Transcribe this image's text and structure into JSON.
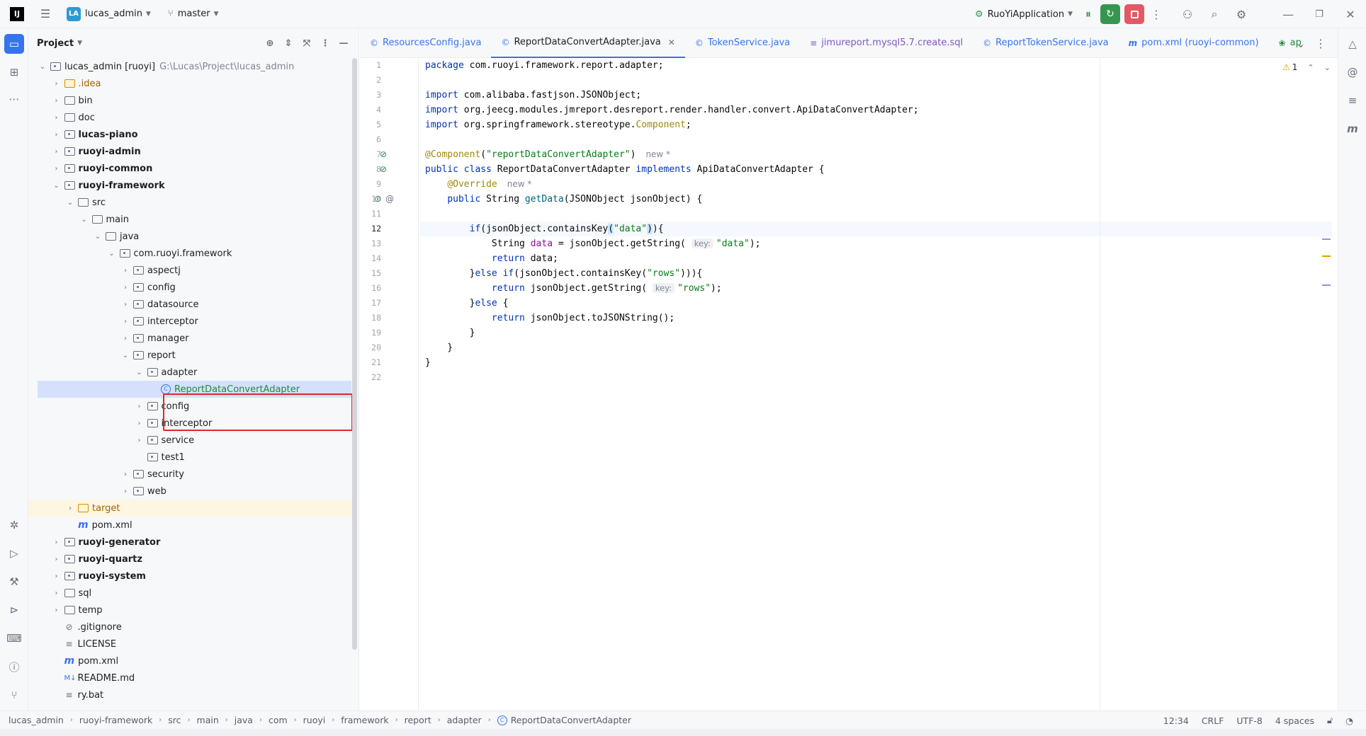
{
  "titlebar": {
    "app_logo": "IJ",
    "project_badge": "LA",
    "project_name": "lucas_admin",
    "branch": "master",
    "run_config": "RuoYiApplication",
    "icons": [
      "hamburger-icon",
      "branch-icon",
      "run-config-icon",
      "debug-icon",
      "rerun-icon",
      "stop-icon",
      "more-icon",
      "add-user-icon",
      "search-icon",
      "settings-icon",
      "minimize-icon",
      "restore-icon",
      "close-icon"
    ]
  },
  "project_panel": {
    "title": "Project",
    "tree": [
      {
        "label": "lucas_admin [ruoyi]",
        "path": "G:\\Lucas\\Project\\lucas_admin",
        "depth": 0,
        "expanded": true,
        "type": "module"
      },
      {
        "label": ".idea",
        "depth": 1,
        "type": "folder",
        "style": "orange"
      },
      {
        "label": "bin",
        "depth": 1,
        "type": "folder"
      },
      {
        "label": "doc",
        "depth": 1,
        "type": "folder"
      },
      {
        "label": "lucas-piano",
        "depth": 1,
        "type": "module",
        "bold": true
      },
      {
        "label": "ruoyi-admin",
        "depth": 1,
        "type": "module",
        "bold": true
      },
      {
        "label": "ruoyi-common",
        "depth": 1,
        "type": "module",
        "bold": true
      },
      {
        "label": "ruoyi-framework",
        "depth": 1,
        "type": "module",
        "bold": true,
        "expanded": true
      },
      {
        "label": "src",
        "depth": 2,
        "type": "folder",
        "expanded": true
      },
      {
        "label": "main",
        "depth": 3,
        "type": "folder",
        "expanded": true
      },
      {
        "label": "java",
        "depth": 4,
        "type": "folder",
        "expanded": true
      },
      {
        "label": "com.ruoyi.framework",
        "depth": 5,
        "type": "package",
        "expanded": true
      },
      {
        "label": "aspectj",
        "depth": 6,
        "type": "package"
      },
      {
        "label": "config",
        "depth": 6,
        "type": "package"
      },
      {
        "label": "datasource",
        "depth": 6,
        "type": "package"
      },
      {
        "label": "interceptor",
        "depth": 6,
        "type": "package"
      },
      {
        "label": "manager",
        "depth": 6,
        "type": "package"
      },
      {
        "label": "report",
        "depth": 6,
        "type": "package",
        "expanded": true
      },
      {
        "label": "adapter",
        "depth": 7,
        "type": "package",
        "expanded": true
      },
      {
        "label": "ReportDataConvertAdapter",
        "depth": 8,
        "type": "class",
        "selected": true,
        "style": "green"
      },
      {
        "label": "config",
        "depth": 7,
        "type": "package"
      },
      {
        "label": "interceptor",
        "depth": 7,
        "type": "package"
      },
      {
        "label": "service",
        "depth": 7,
        "type": "package"
      },
      {
        "label": "test1",
        "depth": 7,
        "type": "package",
        "leaf": true
      },
      {
        "label": "security",
        "depth": 6,
        "type": "package"
      },
      {
        "label": "web",
        "depth": 6,
        "type": "package"
      },
      {
        "label": "target",
        "depth": 2,
        "type": "folder",
        "style": "orange",
        "highlight": true
      },
      {
        "label": "pom.xml",
        "depth": 2,
        "type": "maven",
        "leaf": true
      },
      {
        "label": "ruoyi-generator",
        "depth": 1,
        "type": "module",
        "bold": true
      },
      {
        "label": "ruoyi-quartz",
        "depth": 1,
        "type": "module",
        "bold": true
      },
      {
        "label": "ruoyi-system",
        "depth": 1,
        "type": "module",
        "bold": true
      },
      {
        "label": "sql",
        "depth": 1,
        "type": "folder"
      },
      {
        "label": "temp",
        "depth": 1,
        "type": "folder"
      },
      {
        "label": ".gitignore",
        "depth": 1,
        "type": "ignore",
        "leaf": true
      },
      {
        "label": "LICENSE",
        "depth": 1,
        "type": "text",
        "leaf": true
      },
      {
        "label": "pom.xml",
        "depth": 1,
        "type": "maven",
        "leaf": true
      },
      {
        "label": "README.md",
        "depth": 1,
        "type": "markdown",
        "leaf": true
      },
      {
        "label": "ry.bat",
        "depth": 1,
        "type": "text",
        "leaf": true
      }
    ]
  },
  "tabs": [
    {
      "label": "ResourcesConfig.java",
      "icon": "class-icon",
      "active": false
    },
    {
      "label": "ReportDataConvertAdapter.java",
      "icon": "class-icon",
      "active": true
    },
    {
      "label": "TokenService.java",
      "icon": "class-icon",
      "active": false
    },
    {
      "label": "jimureport.mysql5.7.create.sql",
      "icon": "database-icon",
      "active": false
    },
    {
      "label": "ReportTokenService.java",
      "icon": "class-icon",
      "active": false
    },
    {
      "label": "pom.xml (ruoyi-common)",
      "icon": "maven-icon",
      "active": false
    },
    {
      "label": "ap",
      "icon": "spring-icon",
      "active": false
    }
  ],
  "editor": {
    "warning_count": "1",
    "current_line": 12,
    "lines": [
      {
        "n": "1",
        "tokens": [
          [
            "kw",
            "package "
          ],
          [
            "",
            "com.ruoyi.framework.report.adapter;"
          ]
        ]
      },
      {
        "n": "2",
        "tokens": []
      },
      {
        "n": "3",
        "tokens": [
          [
            "kw",
            "import "
          ],
          [
            "",
            "com.alibaba.fastjson.JSONObject;"
          ]
        ]
      },
      {
        "n": "4",
        "tokens": [
          [
            "kw",
            "import "
          ],
          [
            "",
            "org.jeecg.modules.jmreport.desreport.render.handler.convert.ApiDataConvertAdapter;"
          ]
        ]
      },
      {
        "n": "5",
        "tokens": [
          [
            "kw",
            "import "
          ],
          [
            "",
            "org.springframework.stereotype."
          ],
          [
            "ann",
            "Component"
          ],
          [
            "",
            ";"
          ]
        ]
      },
      {
        "n": "6",
        "tokens": []
      },
      {
        "n": "7",
        "tokens": [
          [
            "ann",
            "@Component"
          ],
          [
            "",
            "("
          ],
          [
            "str",
            "\"reportDataConvertAdapter\""
          ],
          [
            "",
            ")"
          ],
          [
            "new",
            "new *"
          ]
        ]
      },
      {
        "n": "8",
        "tokens": [
          [
            "kw",
            "public class "
          ],
          [
            "",
            "ReportDataConvertAdapter "
          ],
          [
            "kw",
            "implements "
          ],
          [
            "",
            "ApiDataConvertAdapter {"
          ]
        ]
      },
      {
        "n": "9",
        "tokens": [
          [
            "",
            "    "
          ],
          [
            "ann",
            "@Override"
          ],
          [
            "new",
            "new *"
          ]
        ]
      },
      {
        "n": "10",
        "tokens": [
          [
            "",
            "    "
          ],
          [
            "kw",
            "public "
          ],
          [
            "",
            "String "
          ],
          [
            "fn",
            "getData"
          ],
          [
            "",
            "(JSONObject jsonObject) {"
          ]
        ]
      },
      {
        "n": "11",
        "tokens": []
      },
      {
        "n": "12",
        "tokens": [
          [
            "",
            "        "
          ],
          [
            "kw",
            "if"
          ],
          [
            "",
            "(jsonObject.containsKey"
          ],
          [
            "br",
            "("
          ],
          [
            "str",
            "\"data\""
          ],
          [
            "br",
            ")"
          ],
          [
            "",
            "){"
          ]
        ]
      },
      {
        "n": "13",
        "tokens": [
          [
            "",
            "            String "
          ],
          [
            "var",
            "data"
          ],
          [
            "",
            " = jsonObject.getString( "
          ],
          [
            "hint",
            "key:"
          ],
          [
            "str",
            "\"data\""
          ],
          [
            "",
            ");"
          ]
        ]
      },
      {
        "n": "14",
        "tokens": [
          [
            "",
            "            "
          ],
          [
            "kw",
            "return "
          ],
          [
            "",
            "data;"
          ]
        ]
      },
      {
        "n": "15",
        "tokens": [
          [
            "",
            "        }"
          ],
          [
            "kw",
            "else if"
          ],
          [
            "",
            "(jsonObject.containsKey("
          ],
          [
            "str",
            "\"rows\""
          ],
          [
            "",
            "))){"
          ]
        ]
      },
      {
        "n": "16",
        "tokens": [
          [
            "",
            "            "
          ],
          [
            "kw",
            "return "
          ],
          [
            "",
            "jsonObject.getString( "
          ],
          [
            "hint",
            "key:"
          ],
          [
            "str",
            "\"rows\""
          ],
          [
            "",
            ");"
          ]
        ]
      },
      {
        "n": "17",
        "tokens": [
          [
            "",
            "        }"
          ],
          [
            "kw",
            "else "
          ],
          [
            "",
            "{"
          ]
        ]
      },
      {
        "n": "18",
        "tokens": [
          [
            "",
            "            "
          ],
          [
            "kw",
            "return "
          ],
          [
            "",
            "jsonObject.toJSONString();"
          ]
        ]
      },
      {
        "n": "19",
        "tokens": [
          [
            "",
            "        }"
          ]
        ]
      },
      {
        "n": "20",
        "tokens": [
          [
            "",
            "    }"
          ]
        ]
      },
      {
        "n": "21",
        "tokens": [
          [
            "",
            "}"
          ]
        ]
      },
      {
        "n": "22",
        "tokens": []
      }
    ]
  },
  "statusbar": {
    "breadcrumb": [
      "lucas_admin",
      "ruoyi-framework",
      "src",
      "main",
      "java",
      "com",
      "ruoyi",
      "framework",
      "report",
      "adapter",
      "ReportDataConvertAdapter"
    ],
    "position": "12:34",
    "line_sep": "CRLF",
    "encoding": "UTF-8",
    "indent": "4 spaces"
  },
  "colors": {
    "accent": "#3574f0",
    "highlight_box": "#e5242b",
    "run_green": "#369650",
    "stop_red": "#e55765"
  }
}
